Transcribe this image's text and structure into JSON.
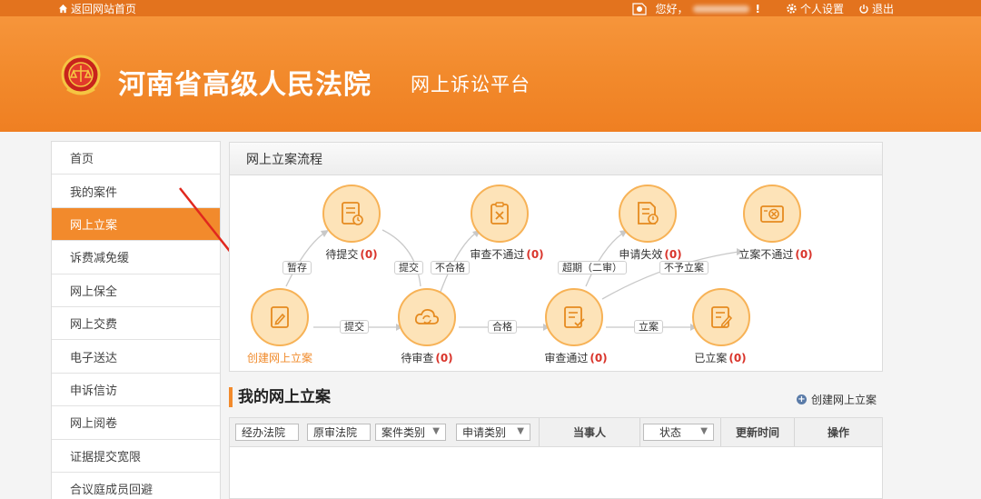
{
  "topbar": {
    "home_label": "返回网站首页",
    "greeting": "您好，",
    "excl": "!",
    "settings_label": "个人设置",
    "logout_label": "退出"
  },
  "banner": {
    "title": "河南省高级人民法院",
    "subtitle": "网上诉讼平台"
  },
  "sidebar": {
    "items": [
      {
        "label": "首页"
      },
      {
        "label": "我的案件"
      },
      {
        "label": "网上立案"
      },
      {
        "label": "诉费减免缓"
      },
      {
        "label": "网上保全"
      },
      {
        "label": "网上交费"
      },
      {
        "label": "电子送达"
      },
      {
        "label": "申诉信访"
      },
      {
        "label": "网上阅卷"
      },
      {
        "label": "证据提交宽限"
      },
      {
        "label": "合议庭成员回避"
      }
    ],
    "active_index": 2
  },
  "flow": {
    "title": "网上立案流程",
    "nodes": {
      "create": {
        "label": "创建网上立案"
      },
      "pending_submit": {
        "label": "待提交",
        "count": "(0)"
      },
      "pending_review": {
        "label": "待审查",
        "count": "(0)"
      },
      "review_failed": {
        "label": "审查不通过",
        "count": "(0)"
      },
      "review_passed": {
        "label": "审查通过",
        "count": "(0)"
      },
      "apply_failed": {
        "label": "申请失效",
        "count": "(0)"
      },
      "not_filed": {
        "label": "立案不通过",
        "count": "(0)"
      },
      "filed": {
        "label": "已立案",
        "count": "(0)"
      }
    },
    "edges": {
      "save": "暂存",
      "submit1": "提交",
      "submit2": "提交",
      "unqualified": "不合格",
      "qualified": "合格",
      "overdue": "超期（二审）",
      "not_accept": "不予立案",
      "file": "立案"
    }
  },
  "mylist": {
    "title": "我的网上立案",
    "create_link": "创建网上立案",
    "filters": {
      "court": "经办法院",
      "orig_court": "原审法院",
      "case_type": "案件类别",
      "apply_type": "申请类别",
      "status": "状态"
    },
    "headers": {
      "party": "当事人",
      "updated": "更新时间",
      "actions": "操作"
    }
  },
  "colors": {
    "accent": "#f28a2c",
    "topbar": "#e3731e",
    "count_red": "#d9342b"
  }
}
